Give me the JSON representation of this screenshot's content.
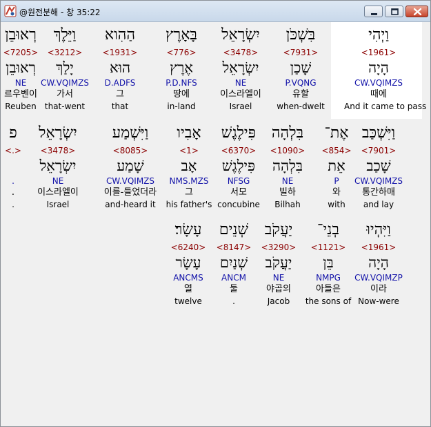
{
  "window": {
    "title": "@원전분해 - 창 35:22"
  },
  "rows": [
    {
      "highlight": 0,
      "words": [
        {
          "heb": "וַיְהִי",
          "strong": "<1961>",
          "lemma": "הָיָה",
          "morph": "CW.VQIMZS",
          "kor": "때에",
          "eng": "And it came to pass"
        },
        {
          "heb": "בִּשְׁכֹּן",
          "strong": "<7931>",
          "lemma": "שָׁכַן",
          "morph": "P.VQNG",
          "kor": "유할",
          "eng": "when-dwelt"
        },
        {
          "heb": "יִשְׂרָאֵל",
          "strong": "<3478>",
          "lemma": "יִשְׂרָאֵל",
          "morph": "NE",
          "kor": "이스라엘이",
          "eng": "Israel"
        },
        {
          "heb": "בָּאָרֶץ",
          "strong": "<776>",
          "lemma": "אֶרֶץ",
          "morph": "P.D.NFS",
          "kor": "땅에",
          "eng": "in-land"
        },
        {
          "heb": "הַהִוא",
          "strong": "<1931>",
          "lemma": "הוּא",
          "morph": "D.ADFS",
          "kor": "그",
          "eng": "that"
        },
        {
          "heb": "וַיֵּלֶךְ",
          "strong": "<3212>",
          "lemma": "יָלַךְ",
          "morph": "CW.VQIMZS",
          "kor": "가서",
          "eng": "that-went"
        },
        {
          "heb": "רְאוּבֵן",
          "strong": "<7205>",
          "lemma": "רְאוּבֵן",
          "morph": "NE",
          "kor": "르우벤이",
          "eng": "Reuben"
        }
      ]
    },
    {
      "words": [
        {
          "heb": "וַיִּשְׁכַּב",
          "strong": "<7901>",
          "lemma": "שָׁכַב",
          "morph": "CW.VQIMZS",
          "kor": "통간하매",
          "eng": "and lay"
        },
        {
          "heb": "אֶת־",
          "strong": "<854>",
          "lemma": "אֵת",
          "morph": "P",
          "kor": "와",
          "eng": "with"
        },
        {
          "heb": "בִּלְהָה",
          "strong": "<1090>",
          "lemma": "בִּלְהָה",
          "morph": "NE",
          "kor": "빌하",
          "eng": "Bilhah"
        },
        {
          "heb": "פִּילֶגֶשׁ",
          "strong": "<6370>",
          "lemma": "פִּילֶגֶשׁ",
          "morph": "NFSG",
          "kor": "서모",
          "eng": "concubine"
        },
        {
          "heb": "אָבִיו",
          "strong": "<1>",
          "lemma": "אָב",
          "morph": "NMS.MZS",
          "kor": "그",
          "eng": "his father's"
        },
        {
          "heb": "וַיִּשְׁמַע",
          "strong": "<8085>",
          "lemma": "שָׁמַע",
          "morph": "CW.VQIMZS",
          "kor": "이를-들었더라",
          "eng": "and-heard it"
        },
        {
          "heb": "יִשְׂרָאֵל",
          "strong": "<3478>",
          "lemma": "יִשְׂרָאֵל",
          "morph": "NE",
          "kor": "이스라엘이",
          "eng": "Israel"
        },
        {
          "heb": "פ",
          "strong": "<.>",
          "lemma": "",
          "morph": ".",
          "kor": ".",
          "eng": "."
        }
      ]
    },
    {
      "words": [
        {
          "heb": "וַיִּהְיוּ",
          "strong": "<1961>",
          "lemma": "הָיָה",
          "morph": "CW.VQIMZP",
          "kor": "이라",
          "eng": "Now-were"
        },
        {
          "heb": "בְנֵי־",
          "strong": "<1121>",
          "lemma": "בֵּן",
          "morph": "NMPG",
          "kor": "아들은",
          "eng": "the sons of"
        },
        {
          "heb": "יַעֲקֹב",
          "strong": "<3290>",
          "lemma": "יַעֲקֹב",
          "morph": "NE",
          "kor": "야곱의",
          "eng": "Jacob"
        },
        {
          "heb": "שְׁנֵים",
          "strong": "<8147>",
          "lemma": "שְׁנַיִם",
          "morph": "ANCM",
          "kor": "둘",
          "eng": "."
        },
        {
          "heb": "עָשָׂר׃",
          "strong": "<6240>",
          "lemma": "עָשָׂר",
          "morph": "ANCMS",
          "kor": "열",
          "eng": "twelve"
        }
      ]
    }
  ]
}
